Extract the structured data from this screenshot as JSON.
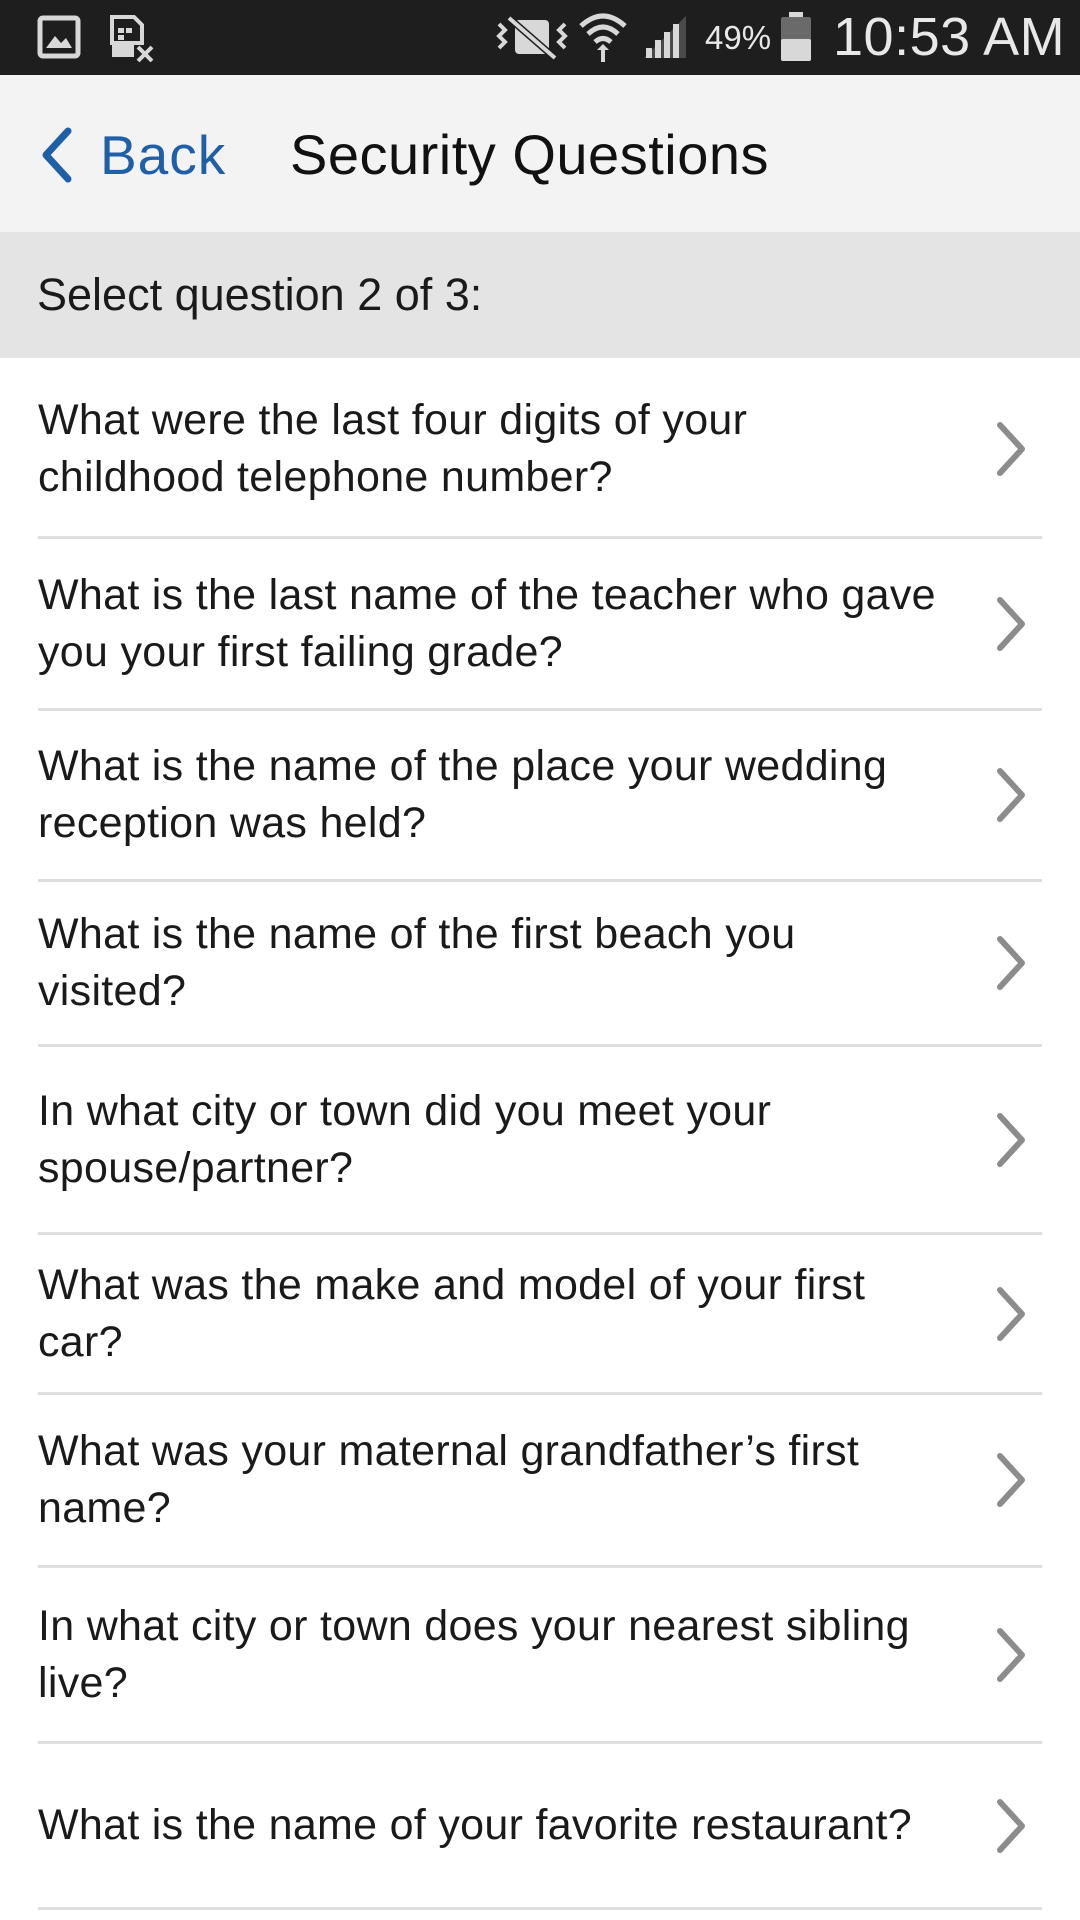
{
  "status_bar": {
    "battery_percent": "49%",
    "time": "10:53 AM",
    "icons": [
      "gallery-icon",
      "no-sim-icon",
      "vibrate-icon",
      "wifi-icon",
      "signal-icon",
      "battery-icon"
    ]
  },
  "header": {
    "back_label": "Back",
    "title": "Security Questions"
  },
  "section": {
    "label": "Select question 2 of 3:"
  },
  "questions": [
    {
      "text": "What were the last four digits of your childhood telephone number?"
    },
    {
      "text": "What is the last name of the teacher who gave you your first failing grade?"
    },
    {
      "text": "What is the name of the place your wedding reception was held?"
    },
    {
      "text": "What is the name of the first beach you visited?"
    },
    {
      "text": "In what city or town did you meet your spouse/partner?"
    },
    {
      "text": "What was the make and model of your first car?"
    },
    {
      "text": "What was your maternal grandfather’s first name?"
    },
    {
      "text": "In what city or town does your nearest sibling live?"
    },
    {
      "text": "What is the name of your favorite restaurant?"
    }
  ],
  "colors": {
    "status_bar_bg": "#1e1e1e",
    "header_bg": "#f3f3f3",
    "section_bg": "#e4e4e4",
    "link_blue": "#1f5fa8",
    "chevron_gray": "#8c8c8c",
    "divider": "#dedede"
  }
}
